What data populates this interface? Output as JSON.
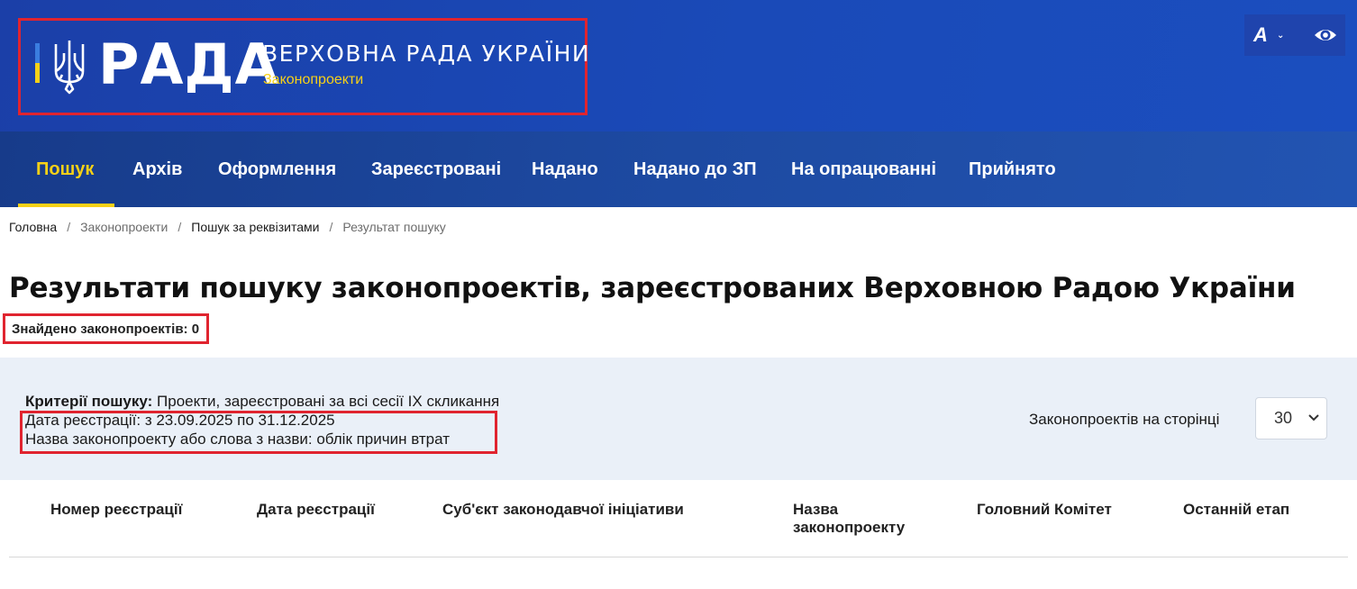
{
  "header": {
    "logo_word": "РАДА",
    "title": "ВЕРХОВНА РАДА УКРАЇНИ",
    "subtitle": "Законопроекти",
    "font_size_button": "A",
    "colors": {
      "header_blue": "#1b45b3",
      "accent_yellow": "#f7d117",
      "highlight_red": "#e0242f"
    }
  },
  "nav": {
    "items": [
      {
        "label": "Пошук",
        "active": true
      },
      {
        "label": "Архів"
      },
      {
        "label": "Оформлення"
      },
      {
        "label": "Зареєстровані"
      },
      {
        "label": "Надано"
      },
      {
        "label": "Надано до ЗП"
      },
      {
        "label": "На опрацюванні"
      },
      {
        "label": "Прийнято"
      }
    ]
  },
  "breadcrumb": {
    "items": [
      "Головна",
      "Законопроекти",
      "Пошук за реквізитами",
      "Результат пошуку"
    ],
    "separator": "/"
  },
  "page": {
    "title": "Результати пошуку законопроектів, зареєстрованих Верховною Радою України",
    "found": "Знайдено законопроектів: 0"
  },
  "criteria": {
    "label": "Критерії пошуку:",
    "line1": "Проекти, зареєстровані за всі сесії IX скликання",
    "line2": "Дата реєстрації: з 23.09.2025 по 31.12.2025",
    "line3": "Назва законопроекту або слова з назви: облік причин втрат"
  },
  "per_page": {
    "label": "Законопроектів на сторінці",
    "value": "30"
  },
  "table": {
    "columns": [
      "Номер реєстрації",
      "Дата реєстрації",
      "Суб'єкт законодавчої ініціативи",
      "Назва законопроекту",
      "Головний Комітет",
      "Останній етап"
    ]
  }
}
